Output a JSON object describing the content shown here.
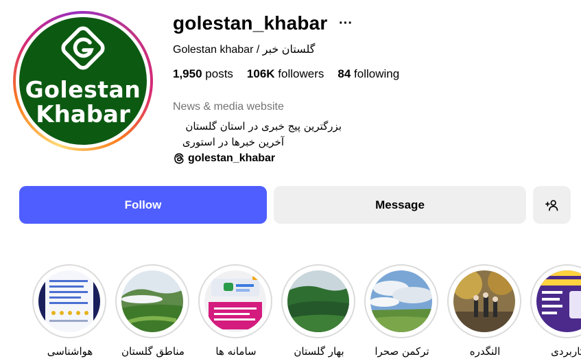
{
  "profile": {
    "logo_line1": "Golestan",
    "logo_line2": "Khabar",
    "username": "golestan_khabar",
    "more_label": "···",
    "fullname": "Golestan khabar / گلستان خبر",
    "category": "News & media website",
    "bio_line1": "بزرگترین پیج خبری در استان گلستان",
    "bio_line2": "آخرین خبرها در استوری",
    "threads_handle": "golestan_khabar"
  },
  "stats": {
    "posts_count": "1,950",
    "posts_label": "posts",
    "followers_count": "106K",
    "followers_label": "followers",
    "following_count": "84",
    "following_label": "following"
  },
  "actions": {
    "follow_label": "Follow",
    "message_label": "Message",
    "add_icon": "add-person-icon"
  },
  "colors": {
    "follow_bg": "#4f5eff",
    "secondary_bg": "#efefef",
    "avatar_green": "#0c5a12",
    "muted_text": "#737373"
  },
  "highlights": [
    {
      "label": "هواشناسی"
    },
    {
      "label": "مناطق گلستان"
    },
    {
      "label": "سامانه ها"
    },
    {
      "label": "بهار گلستان"
    },
    {
      "label": "ترکمن صحرا"
    },
    {
      "label": "النگدره"
    },
    {
      "label": "کاربردی"
    }
  ]
}
